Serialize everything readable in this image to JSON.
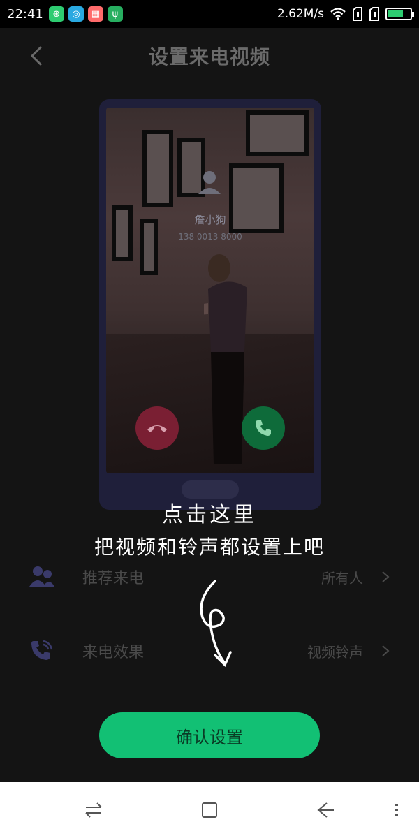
{
  "status_bar": {
    "time": "22:41",
    "net_speed": "2.62M/s",
    "battery_level": 0.7,
    "app_icons": [
      {
        "name": "wechat-pay-icon",
        "color": "#2ecc71",
        "glyph": "⊕"
      },
      {
        "name": "browser-icon",
        "color": "#29a9e1",
        "glyph": "◎"
      },
      {
        "name": "gallery-icon",
        "color": "#ff6b6b",
        "glyph": "▦"
      },
      {
        "name": "usb-icon",
        "color": "#27ae60",
        "glyph": "ψ"
      }
    ]
  },
  "header": {
    "title": "设置来电视频"
  },
  "preview": {
    "contact_name": "詹小狗",
    "contact_number": "138 0013 8000"
  },
  "settings": {
    "rows": [
      {
        "label": "推荐来电",
        "value": "所有人",
        "icon": "contacts-icon"
      },
      {
        "label": "来电效果",
        "value": "视频铃声",
        "icon": "phone-ringing-icon"
      }
    ]
  },
  "confirm_button": {
    "label": "确认设置"
  },
  "annotation": {
    "line1": "点击这里",
    "line2": "把视频和铃声都设置上吧"
  },
  "colors": {
    "accent_green": "#12c074",
    "decline_red": "#7a1f33",
    "accept_green": "#0e6b3a"
  }
}
